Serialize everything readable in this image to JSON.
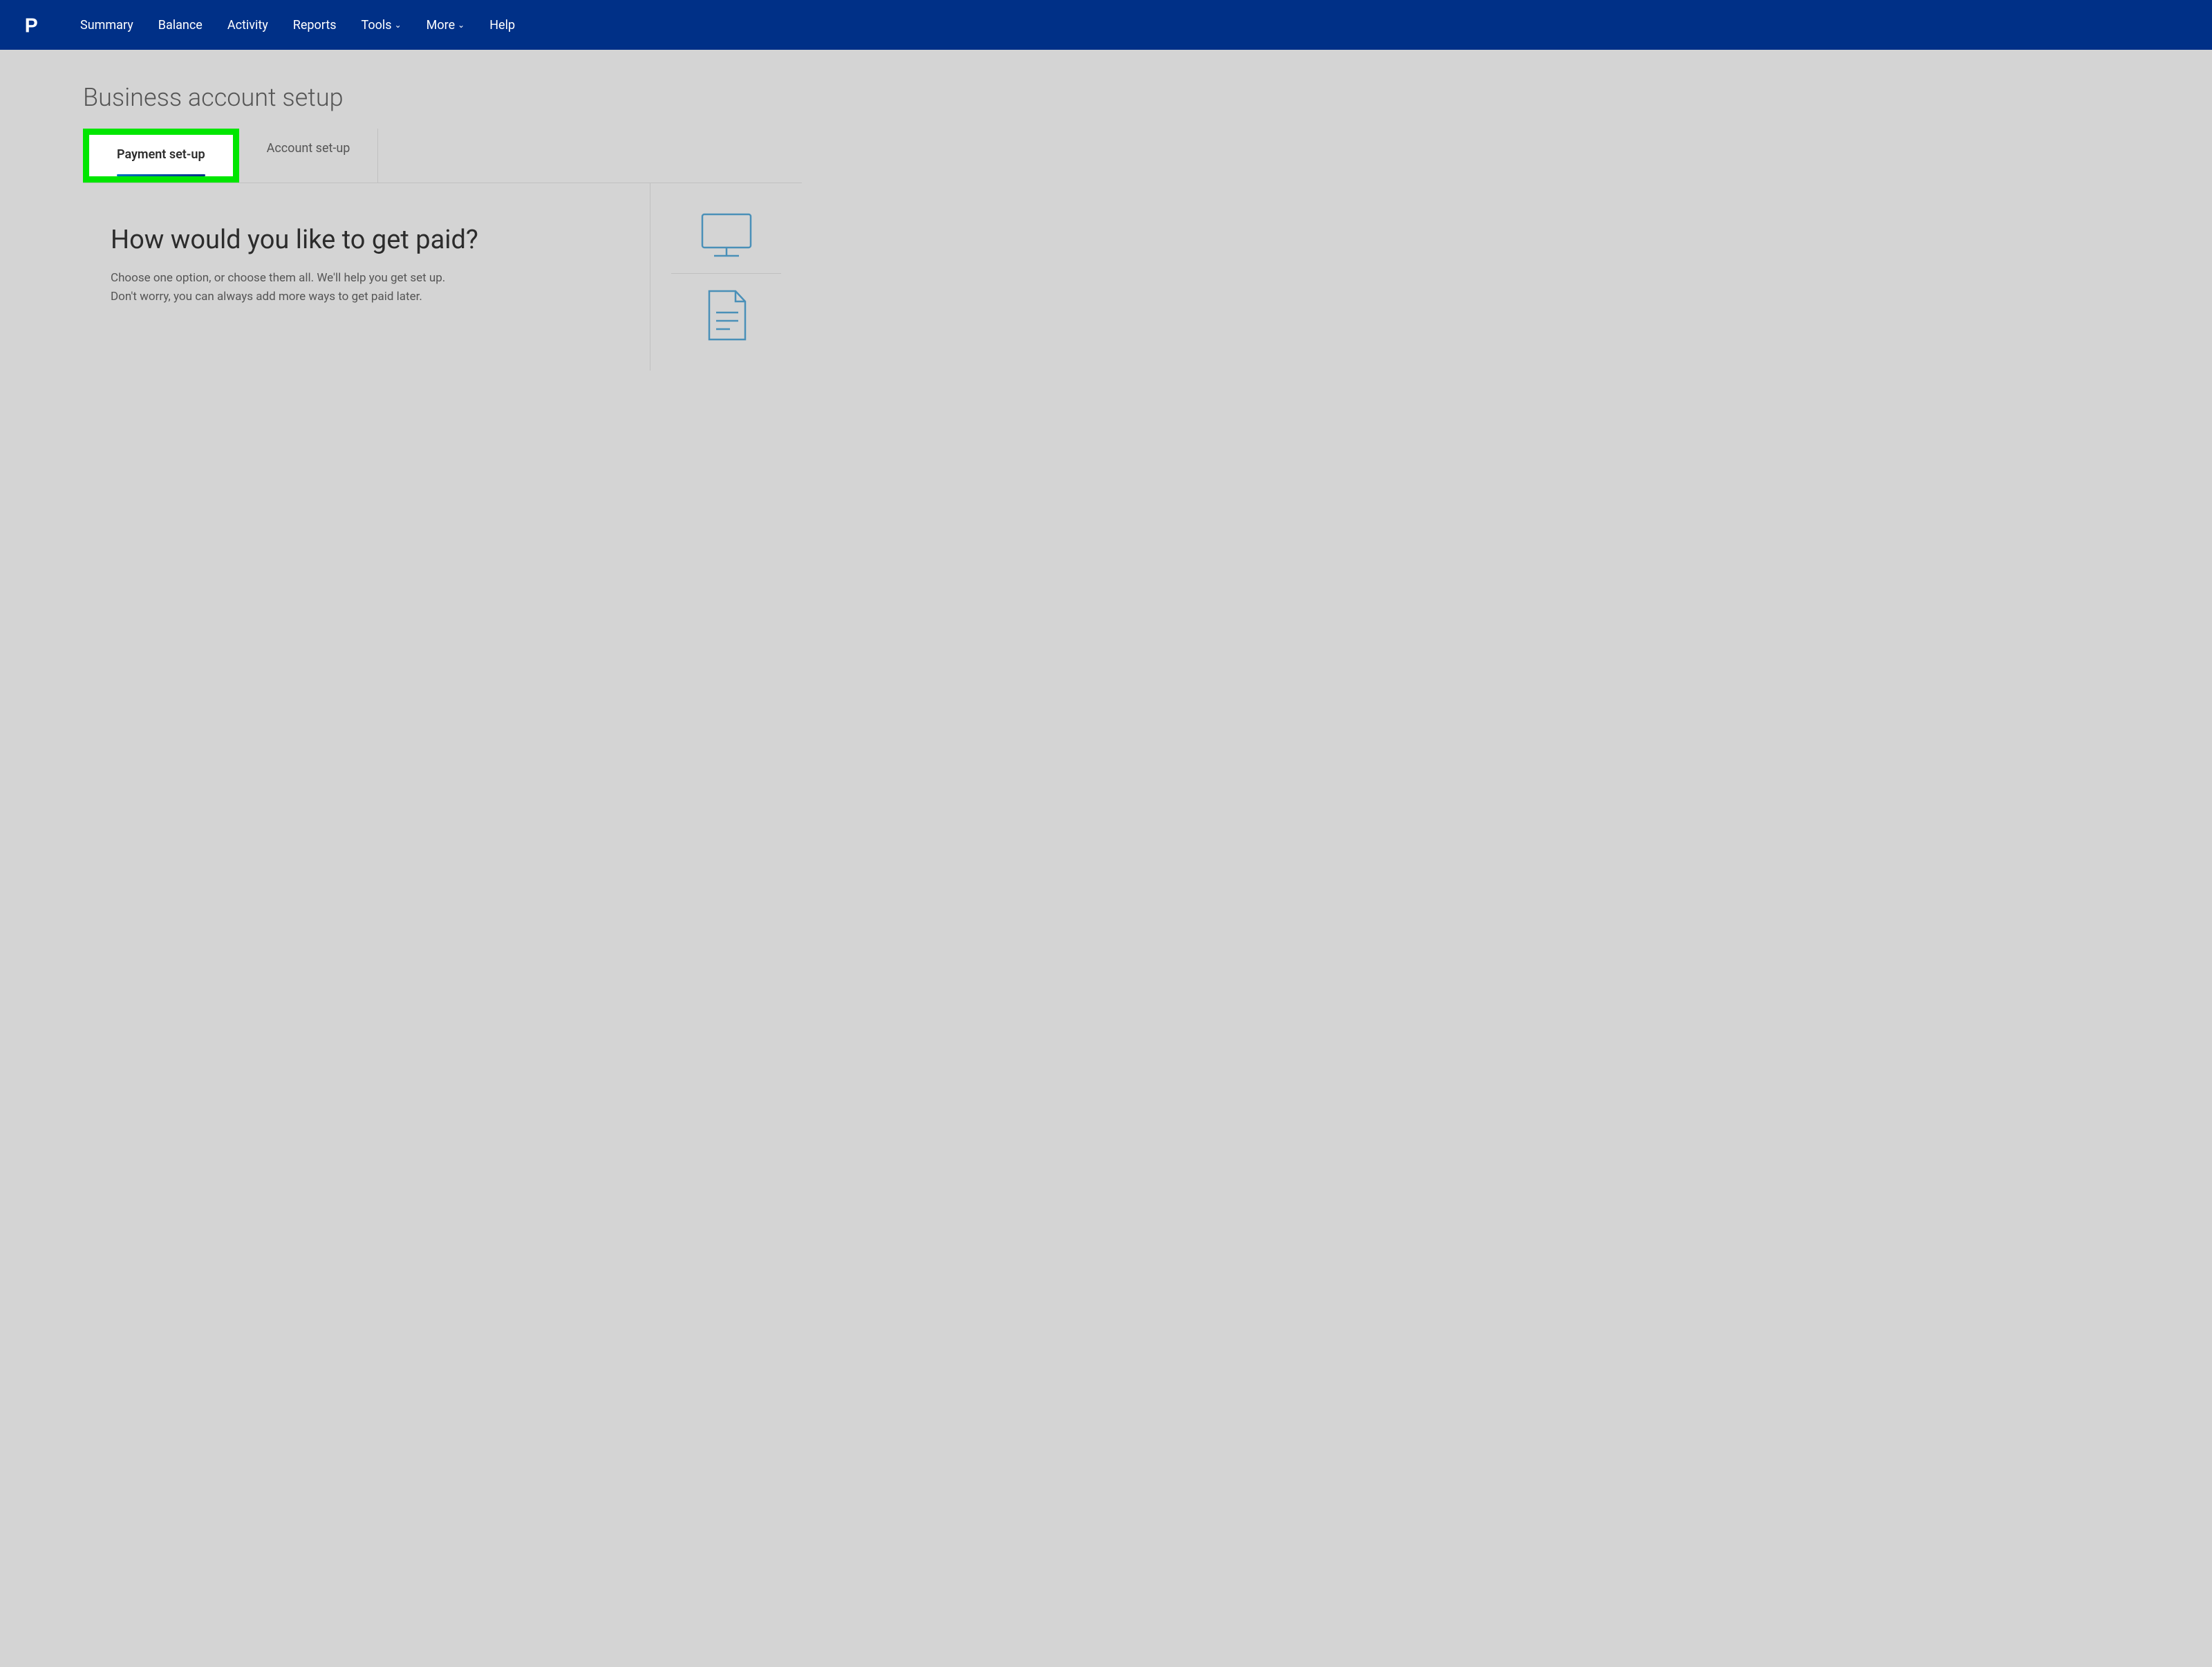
{
  "navbar": {
    "logo_alt": "PayPal",
    "items": [
      {
        "label": "Summary",
        "has_dropdown": false
      },
      {
        "label": "Balance",
        "has_dropdown": false
      },
      {
        "label": "Activity",
        "has_dropdown": false
      },
      {
        "label": "Reports",
        "has_dropdown": false
      },
      {
        "label": "Tools",
        "has_dropdown": true
      },
      {
        "label": "More",
        "has_dropdown": true
      },
      {
        "label": "Help",
        "has_dropdown": false
      }
    ]
  },
  "page": {
    "title": "Business account setup"
  },
  "tabs": [
    {
      "label": "Payment set-up",
      "active": true
    },
    {
      "label": "Account set-up",
      "active": false
    }
  ],
  "content": {
    "heading": "How would you like to get paid?",
    "subtext_line1": "Choose one option, or choose them all. We'll help you get set up.",
    "subtext_line2": "Don't worry, you can always add more ways to get paid later."
  },
  "sidebar": {
    "icons": [
      {
        "name": "monitor-icon",
        "label": "Monitor"
      },
      {
        "name": "document-icon",
        "label": "Document"
      }
    ]
  }
}
